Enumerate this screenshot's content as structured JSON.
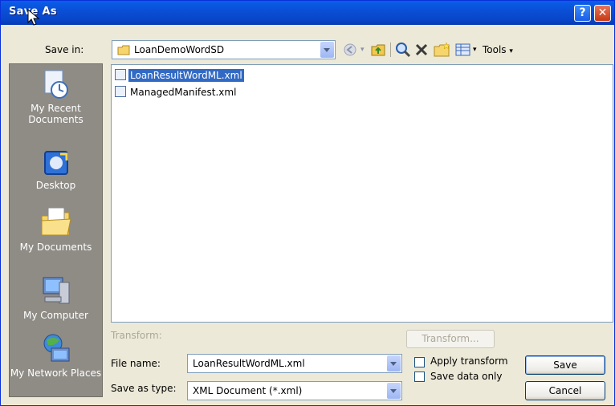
{
  "window": {
    "title": "Save As",
    "help_glyph": "?",
    "close_glyph": "✕"
  },
  "toolbar": {
    "save_in_label": "Save in:",
    "save_in_value": "LoanDemoWordSD",
    "tools_label": "Tools"
  },
  "places": [
    {
      "label": "My Recent Documents",
      "icon": "recent-documents-icon"
    },
    {
      "label": "Desktop",
      "icon": "desktop-icon"
    },
    {
      "label": "My Documents",
      "icon": "my-documents-icon"
    },
    {
      "label": "My Computer",
      "icon": "my-computer-icon"
    },
    {
      "label": "My Network Places",
      "icon": "network-places-icon"
    }
  ],
  "files": [
    {
      "name": "LoanResultWordML.xml",
      "selected": true
    },
    {
      "name": "ManagedManifest.xml",
      "selected": false
    }
  ],
  "form": {
    "transform_label": "Transform:",
    "transform_button": "Transform...",
    "file_name_label": "File name:",
    "file_name_value": "LoanResultWordML.xml",
    "save_as_type_label": "Save as type:",
    "save_as_type_value": "XML Document (*.xml)",
    "apply_transform_label": "Apply transform",
    "save_data_only_label": "Save data only",
    "save_button": "Save",
    "cancel_button": "Cancel"
  },
  "colors": {
    "title_bar": "#0a4fd6",
    "selection": "#316ac5",
    "places_bar": "#8f8c86",
    "dialog_face": "#ece9d8"
  }
}
